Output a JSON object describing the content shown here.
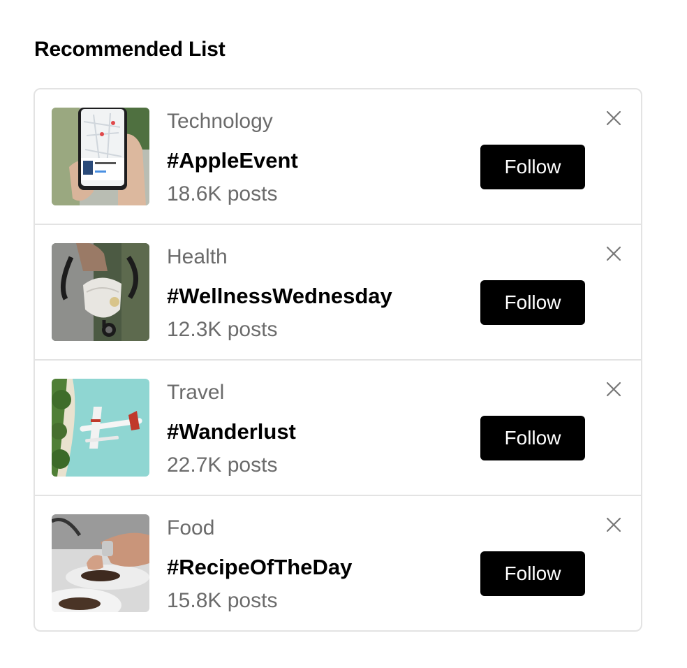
{
  "heading": "Recommended List",
  "items": [
    {
      "category": "Technology",
      "tag": "#AppleEvent",
      "posts": "18.6K posts",
      "follow_label": "Follow",
      "image": "phone-map-photo"
    },
    {
      "category": "Health",
      "tag": "#WellnessWednesday",
      "posts": "12.3K posts",
      "follow_label": "Follow",
      "image": "stethoscope-mask-photo"
    },
    {
      "category": "Travel",
      "tag": "#Wanderlust",
      "posts": "22.7K posts",
      "follow_label": "Follow",
      "image": "seaplane-beach-photo"
    },
    {
      "category": "Food",
      "tag": "#RecipeOfTheDay",
      "posts": "15.8K posts",
      "follow_label": "Follow",
      "image": "chef-plating-photo"
    }
  ],
  "colors": {
    "button_bg": "#000000",
    "button_text": "#ffffff",
    "muted_text": "#6b6b6b",
    "border": "#e3e3e3"
  }
}
